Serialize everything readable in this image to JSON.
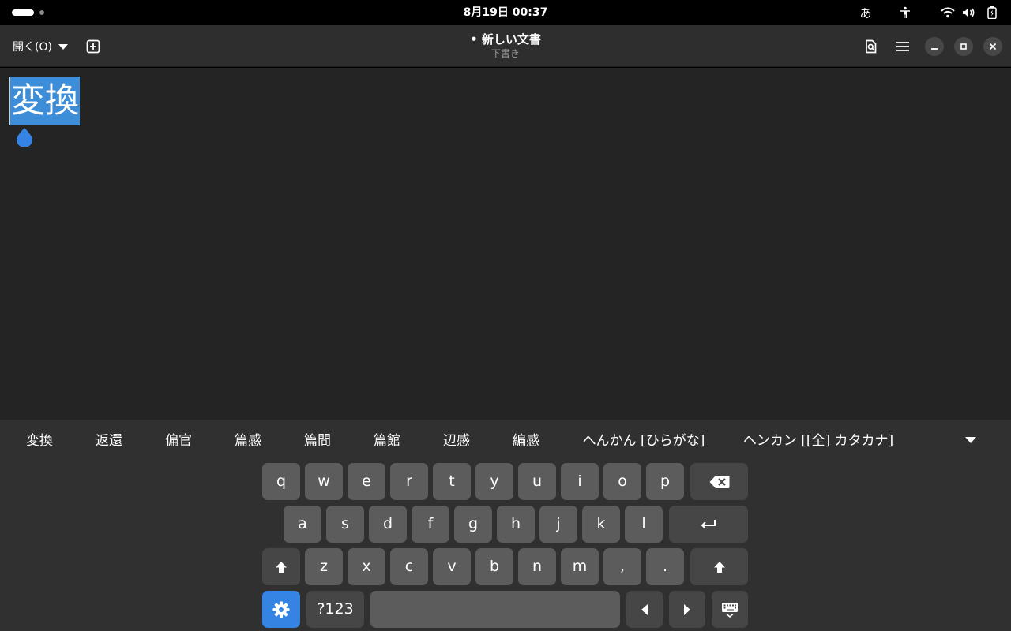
{
  "topbar": {
    "datetime": "8月19日  00:37",
    "ime_indicator": "あ",
    "icons": [
      "workspace-indicator-icon",
      "accessibility-icon",
      "wifi-icon",
      "volume-icon",
      "battery-icon"
    ]
  },
  "headerbar": {
    "open_label": "開く(O)",
    "title": "• 新しい文書",
    "subtitle": "下書き",
    "icons": [
      "new-document-icon",
      "find-icon",
      "menu-icon",
      "minimize-icon",
      "maximize-icon",
      "close-icon"
    ]
  },
  "editor": {
    "text": "変換",
    "selection_color": "#3d8ed8",
    "handle_color": "#3584e4"
  },
  "keyboard": {
    "candidates": [
      "変換",
      "返還",
      "偏官",
      "篇感",
      "篇間",
      "篇館",
      "辺感",
      "編感",
      "へんかん [ひらがな]",
      "ヘンカン [[全] カタカナ]"
    ],
    "row1": [
      "q",
      "w",
      "e",
      "r",
      "t",
      "y",
      "u",
      "i",
      "o",
      "p"
    ],
    "row2": [
      "a",
      "s",
      "d",
      "f",
      "g",
      "h",
      "j",
      "k",
      "l"
    ],
    "row3": [
      "z",
      "x",
      "c",
      "v",
      "b",
      "n",
      "m",
      ",",
      "."
    ],
    "numbers_label": "?123",
    "special_icons": [
      "backspace-icon",
      "enter-icon",
      "shift-icon",
      "settings-icon",
      "arrow-left-icon",
      "arrow-right-icon",
      "hide-keyboard-icon"
    ],
    "accent_color": "#3584e4"
  }
}
